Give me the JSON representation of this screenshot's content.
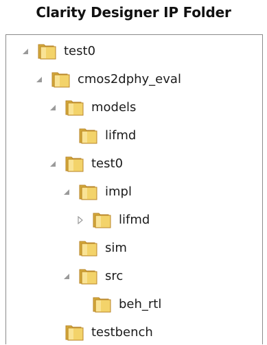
{
  "header": {
    "title": "Clarity Designer IP Folder"
  },
  "tree": [
    {
      "label": "test0",
      "level": 0,
      "expander": "expanded"
    },
    {
      "label": "cmos2dphy_eval",
      "level": 1,
      "expander": "expanded"
    },
    {
      "label": "models",
      "level": 2,
      "expander": "expanded"
    },
    {
      "label": "lifmd",
      "level": 3,
      "expander": "none"
    },
    {
      "label": "test0",
      "level": 2,
      "expander": "expanded"
    },
    {
      "label": "impl",
      "level": 3,
      "expander": "expanded"
    },
    {
      "label": "lifmd",
      "level": 4,
      "expander": "collapsed"
    },
    {
      "label": "sim",
      "level": 3,
      "expander": "none"
    },
    {
      "label": "src",
      "level": 3,
      "expander": "expanded"
    },
    {
      "label": "beh_rtl",
      "level": 4,
      "expander": "none"
    },
    {
      "label": "testbench",
      "level": 2,
      "expander": "none"
    }
  ],
  "icons": {
    "folder": "folder-icon",
    "expanded": "expanded-triangle-icon",
    "collapsed": "collapsed-triangle-icon"
  },
  "colors": {
    "folder_front": "#f3d36a",
    "folder_back": "#d4a93a",
    "folder_edge": "#b8862a",
    "expander": "#9a9a9a",
    "frame_border": "#8a8a8a"
  }
}
